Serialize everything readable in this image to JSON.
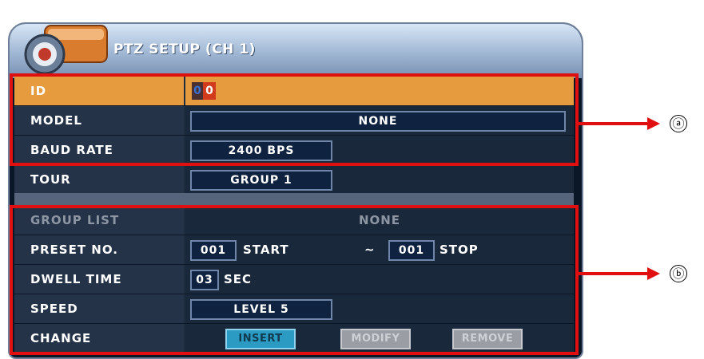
{
  "title": "PTZ SETUP (CH 1)",
  "rows": {
    "id": {
      "label": "ID",
      "digit1": "0",
      "digit2": "0"
    },
    "model": {
      "label": "MODEL",
      "value": "NONE"
    },
    "baud": {
      "label": "BAUD RATE",
      "value": "2400 BPS"
    },
    "tour": {
      "label": "TOUR",
      "value": "GROUP 1"
    },
    "group_list": {
      "label": "GROUP LIST",
      "value": "NONE"
    },
    "preset": {
      "label": "PRESET NO.",
      "start_num": "001",
      "start_label": "START",
      "dash": "~",
      "stop_num": "001",
      "stop_label": "STOP"
    },
    "dwell": {
      "label": "DWELL TIME",
      "value": "03",
      "unit": "SEC"
    },
    "speed": {
      "label": "SPEED",
      "value": "LEVEL 5"
    },
    "change": {
      "label": "CHANGE",
      "insert": "INSERT",
      "modify": "MODIFY",
      "remove": "REMOVE"
    }
  },
  "annotations": {
    "a": "ⓐ",
    "b": "ⓑ"
  },
  "colors": {
    "selected": "#e79b3f",
    "highlight": "#e01010",
    "insert_btn": "#2b9bc4"
  }
}
